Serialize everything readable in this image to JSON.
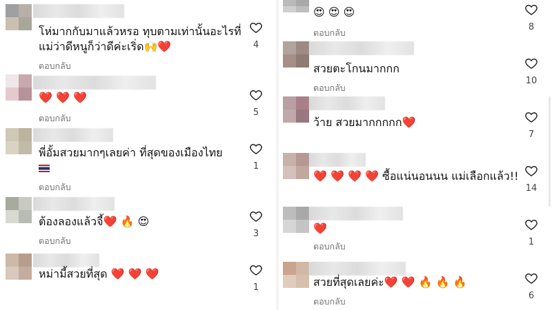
{
  "reply_label": "ตอบกลับ",
  "left": [
    {
      "text": "โห่มากกับมาแล้วหรอ ทุบตามเท่านั้นอะไรที่",
      "text2": "แม่ว่าดีหนูก็ว่าดีค่ะเริ่ด🙌❤️",
      "likes": "4"
    },
    {
      "text": "❤️ ❤️ ❤️",
      "likes": "5"
    },
    {
      "text": "พี่อั้มสวยมากๆเลยค่า ที่สุดของเมืองไทย",
      "likes": "1"
    },
    {
      "text": "ต้องลองแล้วจี้❤️ 🔥 😍",
      "likes": "3"
    },
    {
      "text": "หม่ามี้สวยที่สุด ❤️ ❤️ ❤️",
      "likes": "1"
    }
  ],
  "right": [
    {
      "text": "😍 😍 😍",
      "likes": "8"
    },
    {
      "text": "สวยตะโกนมากกก",
      "likes": "10"
    },
    {
      "text": "ว้าย สวยมากกกกก❤️",
      "likes": "7"
    },
    {
      "text": "❤️ ❤️ ❤️ ❤️ ซื้อแน่นอนนน แม่เลือกแล้ว!!",
      "likes": "14"
    },
    {
      "text": "❤️",
      "likes": "1"
    },
    {
      "text": "สวยที่สุดเลยค่ะ❤️ ❤️ 🔥 🔥 🔥",
      "likes": "6"
    }
  ],
  "colors": {
    "text": "#111111",
    "reply": "#737373",
    "heart_outline": "#262626"
  }
}
